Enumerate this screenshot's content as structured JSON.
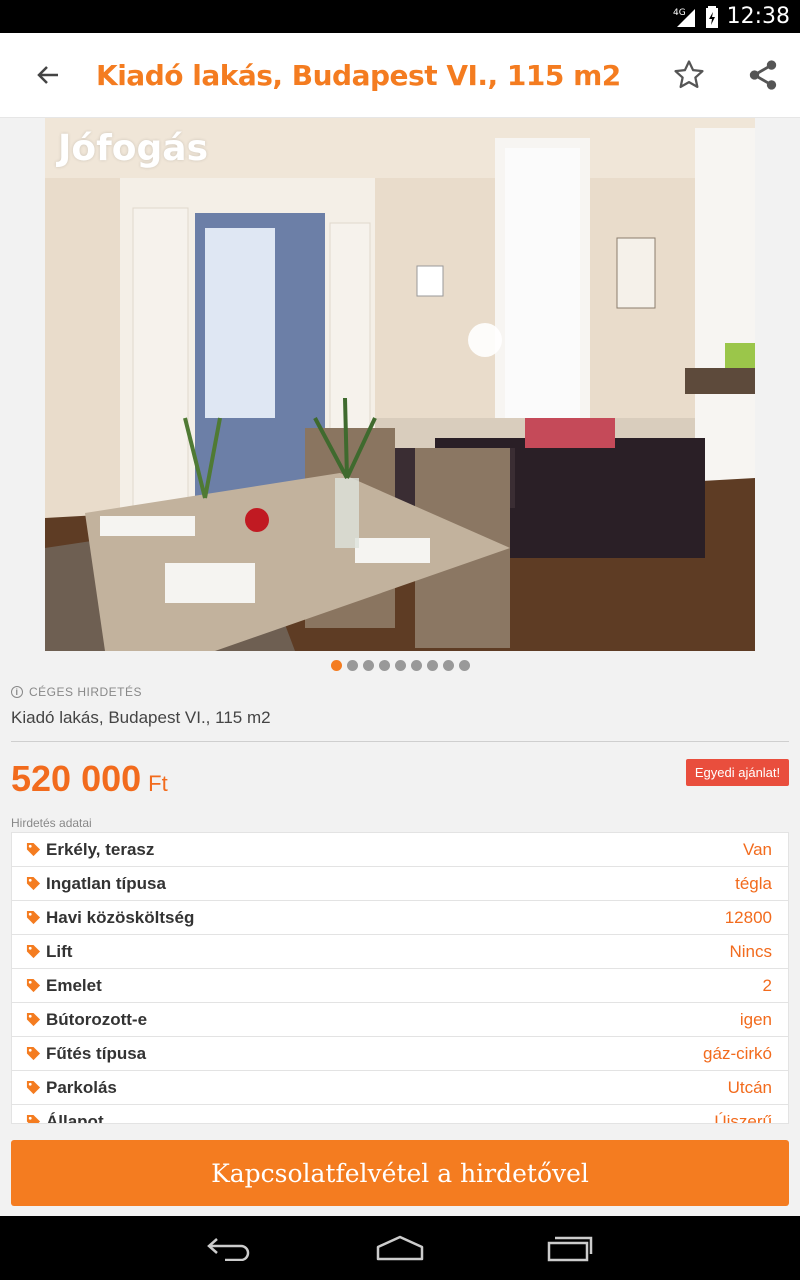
{
  "status_bar": {
    "time": "12:38",
    "network": "4G"
  },
  "app_bar": {
    "title": "Kiadó lakás, Budapest VI., 115 m2"
  },
  "gallery": {
    "watermark": "Jófogás",
    "total_images": 9,
    "active_index": 0
  },
  "ad": {
    "type_label": "CÉGES HIRDETÉS",
    "subtitle": "Kiadó lakás, Budapest VI., 115 m2",
    "price_amount": "520 000",
    "price_currency": "Ft",
    "offer_button": "Egyedi ajánlat!"
  },
  "details": {
    "section_label": "Hirdetés adatai",
    "rows": [
      {
        "label": "Erkély, terasz",
        "value": "Van"
      },
      {
        "label": "Ingatlan típusa",
        "value": "tégla"
      },
      {
        "label": "Havi közösköltség",
        "value": "12800"
      },
      {
        "label": "Lift",
        "value": "Nincs"
      },
      {
        "label": "Emelet",
        "value": "2"
      },
      {
        "label": "Bútorozott-e",
        "value": "igen"
      },
      {
        "label": "Fűtés típusa",
        "value": "gáz-cirkó"
      },
      {
        "label": "Parkolás",
        "value": "Utcán"
      },
      {
        "label": "Állapot",
        "value": "Újszerű"
      }
    ]
  },
  "cta": {
    "label": "Kapcsolatfelvétel a hirdetővel"
  },
  "colors": {
    "accent": "#f47c20",
    "price": "#f26b1d",
    "offer": "#e94e3d"
  },
  "icons": [
    "back-arrow-icon",
    "star-icon",
    "share-icon",
    "tag-icon",
    "info-icon",
    "nav-back-icon",
    "nav-home-icon",
    "nav-recents-icon"
  ]
}
